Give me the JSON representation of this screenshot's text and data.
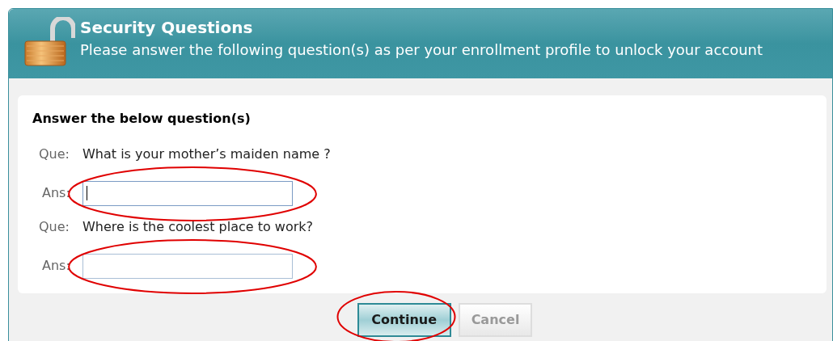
{
  "header": {
    "title": "Security Questions",
    "subtitle": "Please answer the following question(s) as per your enrollment profile to unlock your account"
  },
  "form": {
    "heading": "Answer the below question(s)",
    "questions": [
      {
        "question_label": "Que:",
        "question": "What is your mother’s maiden name ?",
        "answer_label": "Ans:",
        "focused": true,
        "circled": true
      },
      {
        "question_label": "Que:",
        "question": "Where is the coolest place to work?",
        "answer_label": "Ans:",
        "focused": false,
        "circled": true
      }
    ]
  },
  "buttons": [
    {
      "label": "Continue",
      "kind": "primary",
      "disabled": false,
      "circled": true
    },
    {
      "label": "Cancel",
      "kind": "secondary",
      "disabled": true,
      "circled": false
    }
  ]
}
